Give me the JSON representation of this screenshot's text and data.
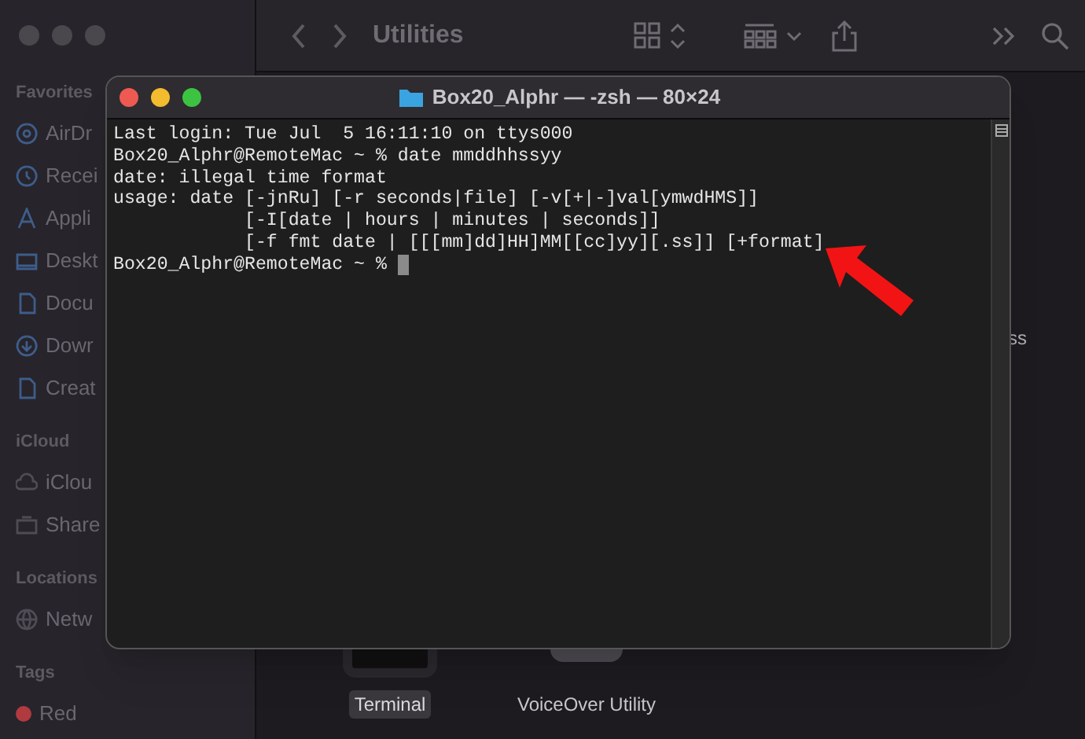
{
  "finder": {
    "title": "Utilities",
    "sidebar": [
      {
        "heading": "Favorites",
        "items": [
          "AirDr",
          "Recei",
          "Appli",
          "Deskt",
          "Docu",
          "Dowr",
          "Creat"
        ]
      },
      {
        "heading": "iCloud",
        "items": [
          "iClou",
          "Share"
        ]
      },
      {
        "heading": "Locations",
        "items": [
          "Netw"
        ]
      },
      {
        "heading": "Tags",
        "items": [
          "Red"
        ]
      }
    ],
    "fragment": "ss",
    "files": [
      {
        "label": "Terminal",
        "selected": true
      },
      {
        "label": "VoiceOver Utility",
        "selected": false
      }
    ]
  },
  "terminal": {
    "title": "Box20_Alphr — -zsh — 80×24",
    "lines": [
      "Last login: Tue Jul  5 16:11:10 on ttys000",
      "Box20_Alphr@RemoteMac ~ % date mmddhhssyy",
      "date: illegal time format",
      "usage: date [-jnRu] [-r seconds|file] [-v[+|-]val[ymwdHMS]]",
      "            [-I[date | hours | minutes | seconds]]",
      "            [-f fmt date | [[[mm]dd]HH]MM[[cc]yy][.ss]] [+format]"
    ],
    "prompt": "Box20_Alphr@RemoteMac ~ % "
  }
}
